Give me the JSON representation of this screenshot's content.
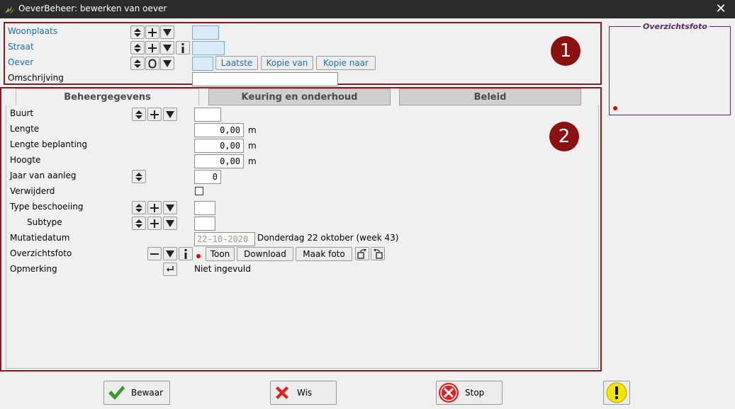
{
  "window": {
    "title": "OeverBeheer: bewerken van oever",
    "close_glyph": "✕"
  },
  "section1": {
    "badge": "1",
    "woonplaats_label": "Woonplaats",
    "straat_label": "Straat",
    "oever_label": "Oever",
    "omschrijving_label": "Omschrijving",
    "buttons": {
      "laatste": "Laatste",
      "kopie_van": "Kopie van",
      "kopie_naar": "Kopie naar"
    }
  },
  "tabs": [
    {
      "label": "Beheergegevens",
      "active": true
    },
    {
      "label": "Keuring en onderhoud",
      "active": false
    },
    {
      "label": "Beleid",
      "active": false
    }
  ],
  "section2": {
    "badge": "2",
    "buurt_label": "Buurt",
    "lengte_label": "Lengte",
    "lengte_value": "0,00",
    "lengte_beplanting_label": "Lengte beplanting",
    "lengte_beplanting_value": "0,00",
    "hoogte_label": "Hoogte",
    "hoogte_value": "0,00",
    "unit_m": "m",
    "jaar_label": "Jaar van aanleg",
    "jaar_value": "0",
    "verwijderd_label": "Verwijderd",
    "verwijderd_checked": false,
    "type_beschoeiing_label": "Type beschoeiing",
    "subtype_label": "Subtype",
    "mutatiedatum_label": "Mutatiedatum",
    "mutatiedatum_value": "22-10-2020",
    "mutatiedatum_text": "Donderdag 22 oktober (week 43)",
    "overzichtsfoto_label": "Overzichtsfoto",
    "foto_buttons": {
      "toon": "Toon",
      "download": "Download",
      "maak_foto": "Maak foto"
    },
    "opmerking_label": "Opmerking",
    "opmerking_value": "Niet ingevuld"
  },
  "photo_panel": {
    "title": "Overzichtsfoto"
  },
  "bottom": {
    "bewaar": "Bewaar",
    "wis": "Wis",
    "stop": "Stop"
  },
  "colors": {
    "accent_frame": "#8b1a1a",
    "link_blue": "#1a6fb8",
    "photo_purple": "#5a2a6a"
  }
}
